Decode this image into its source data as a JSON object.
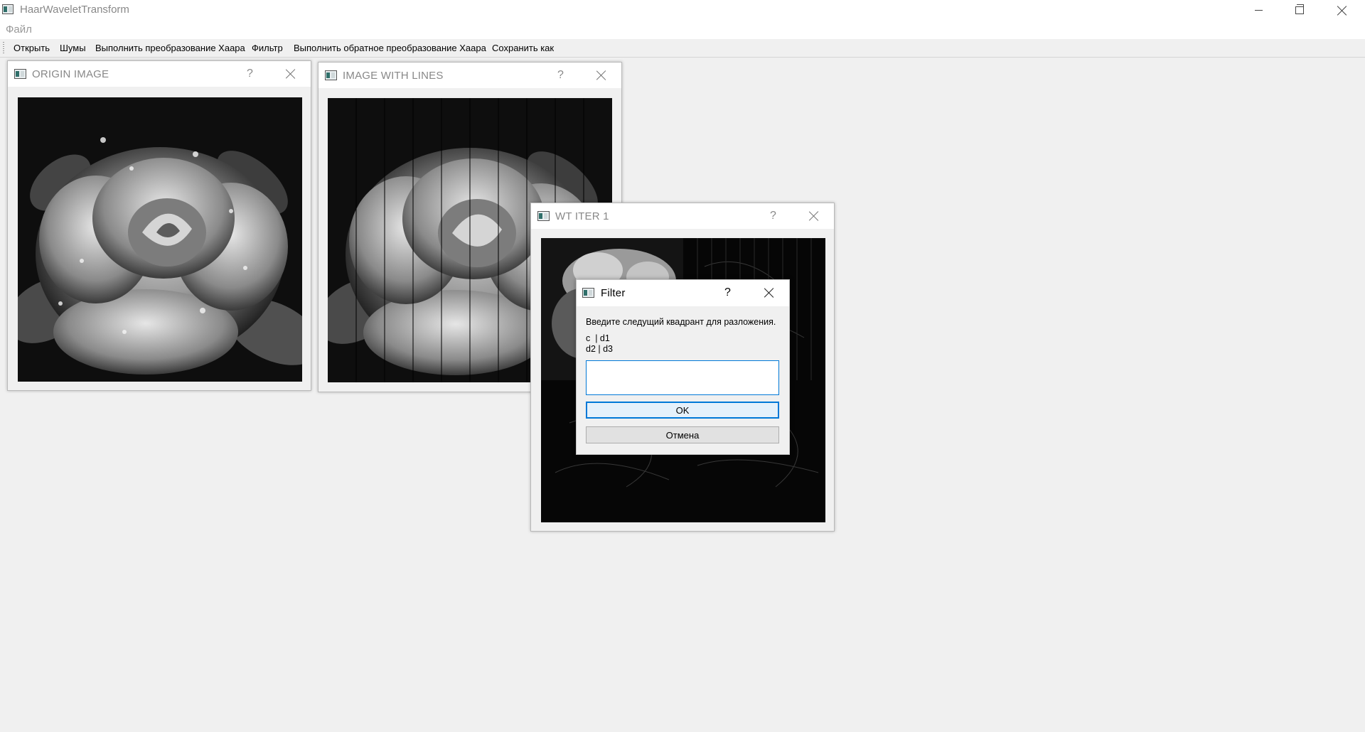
{
  "window": {
    "title": "HaarWaveletTransform",
    "icon": "app-window-icon"
  },
  "menu": {
    "file": "Файл"
  },
  "toolbar": {
    "open": "Открыть",
    "noise": "Шумы",
    "haar": "Выполнить преобразование Хаара",
    "filter": "Фильтр",
    "inverse_haar": "Выполнить обратное преобразование Хаара",
    "save_as": "Сохранить как"
  },
  "subwindows": {
    "origin": {
      "title": "ORIGIN IMAGE",
      "help": "?"
    },
    "lines": {
      "title": "IMAGE WITH LINES",
      "help": "?"
    },
    "wt": {
      "title": "WT ITER 1",
      "help": "?"
    }
  },
  "dialog": {
    "title": "Filter",
    "help": "?",
    "prompt": "Введите следущий квадрант для разложения.",
    "line1": "c  | d1",
    "line2": "d2 | d3",
    "input_value": "",
    "ok": "OK",
    "cancel": "Отмена"
  },
  "colors": {
    "accent": "#0078d7",
    "background": "#f0f0f0"
  }
}
